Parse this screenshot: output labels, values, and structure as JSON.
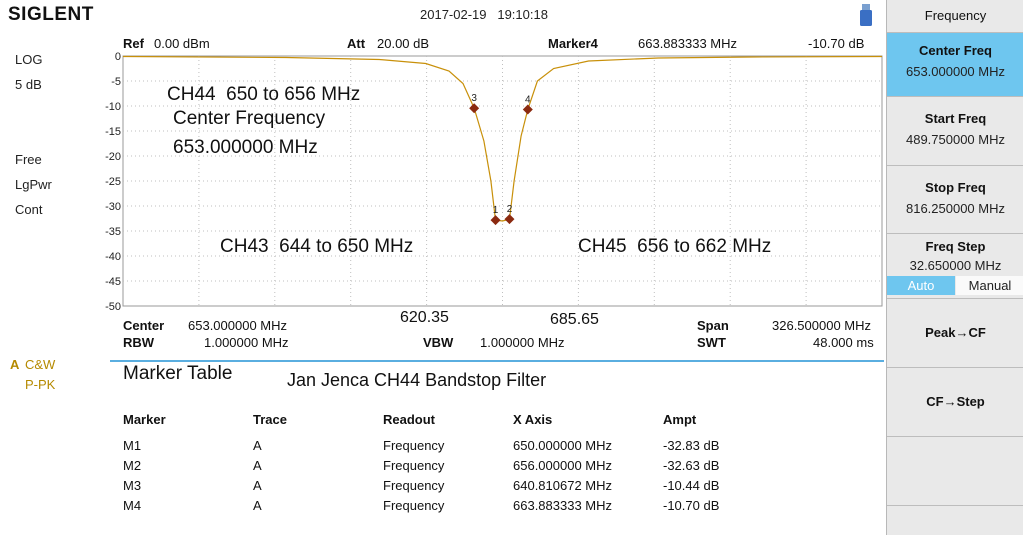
{
  "top": {
    "logo": "SIGLENT",
    "datetime": "2017-02-19   19:10:18"
  },
  "left_panel": {
    "scale_type": "LOG",
    "scale_div": "5 dB",
    "trigger": "Free",
    "detector": "LgPwr",
    "sweep": "Cont",
    "trace_letter": "A",
    "trace_mode": "C&W",
    "trace_detect": "P-PK"
  },
  "header": {
    "ref_label": "Ref",
    "ref_value": "0.00 dBm",
    "att_label": "Att",
    "att_value": "20.00 dB",
    "marker_label": "Marker4",
    "marker_freq": "663.883333 MHz",
    "marker_ampl": "-10.70 dB"
  },
  "plot": {
    "y_ticks": [
      "0",
      "-5",
      "-10",
      "-15",
      "-20",
      "-25",
      "-30",
      "-35",
      "-40",
      "-45",
      "-50"
    ],
    "trace_color": "#c8900a",
    "marker_color": "#8b2a10",
    "grid_color": "#bfbfbf"
  },
  "chart_data": {
    "type": "line",
    "y_scale": "dB",
    "ylim": [
      -50,
      0
    ],
    "x_range_mhz": [
      489.75,
      816.25
    ],
    "series": [
      {
        "x": [
          489.75,
          560,
          600,
          620,
          630,
          636,
          640.81,
          645,
          648,
          650,
          653,
          656,
          658,
          661,
          663.88,
          668,
          675,
          690,
          720,
          760,
          816.25
        ],
        "y": [
          -0.1,
          -0.3,
          -0.7,
          -1.5,
          -3,
          -5.5,
          -10.44,
          -17,
          -25,
          -32.83,
          -33,
          -32.63,
          -25,
          -16,
          -10.7,
          -5,
          -2.5,
          -1,
          -0.4,
          -0.2,
          -0.1
        ]
      }
    ],
    "markers": [
      {
        "label": "1",
        "x": 650.0,
        "y": -32.83
      },
      {
        "label": "2",
        "x": 656.0,
        "y": -32.63
      },
      {
        "label": "3",
        "x": 640.810672,
        "y": -10.44
      },
      {
        "label": "4",
        "x": 663.883333,
        "y": -10.7
      }
    ]
  },
  "annotations": {
    "ch44_line1": "CH44  650 to 656 MHz",
    "ch44_line2": "Center Frequency",
    "ch44_line3": "653.000000 MHz",
    "ch43": "CH43  644 to 650 MHz",
    "ch45": "CH45  656 to 662 MHz",
    "freq_left": "620.35",
    "freq_right": "685.65"
  },
  "bottom": {
    "center_label": "Center",
    "center_value": "653.000000 MHz",
    "rbw_label": "RBW",
    "rbw_value": "1.000000 MHz",
    "vbw_label": "VBW",
    "vbw_value": "1.000000 MHz",
    "span_label": "Span",
    "span_value": "326.500000 MHz",
    "swt_label": "SWT",
    "swt_value": "48.000 ms"
  },
  "marker_table": {
    "title": "Marker Table",
    "subtitle": "Jan Jenca CH44 Bandstop Filter",
    "columns": [
      "Marker",
      "Trace",
      "Readout",
      "X Axis",
      "Ampt"
    ],
    "rows": [
      [
        "M1",
        "A",
        "Frequency",
        "650.000000 MHz",
        "-32.83 dB"
      ],
      [
        "M2",
        "A",
        "Frequency",
        "656.000000 MHz",
        "-32.63 dB"
      ],
      [
        "M3",
        "A",
        "Frequency",
        "640.810672 MHz",
        "-10.44 dB"
      ],
      [
        "M4",
        "A",
        "Frequency",
        "663.883333 MHz",
        "-10.70 dB"
      ]
    ]
  },
  "softkeys": {
    "menu_title": "Frequency",
    "center_freq_label": "Center Freq",
    "center_freq_value": "653.000000 MHz",
    "start_freq_label": "Start Freq",
    "start_freq_value": "489.750000 MHz",
    "stop_freq_label": "Stop Freq",
    "stop_freq_value": "816.250000 MHz",
    "freq_step_label": "Freq Step",
    "freq_step_value": "32.650000 MHz",
    "auto_label": "Auto",
    "manual_label": "Manual",
    "peak_cf_label": "Peak→CF",
    "cf_step_label": "CF→Step",
    "accent_color": "#6ec6ef"
  }
}
